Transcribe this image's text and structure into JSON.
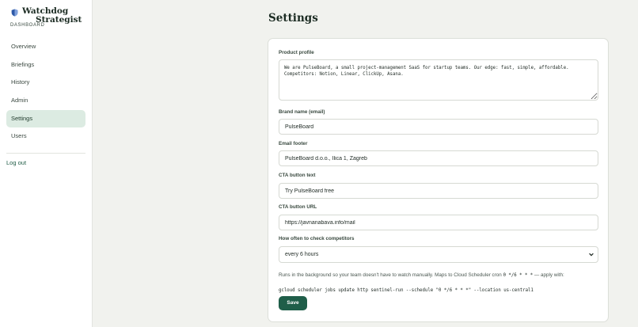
{
  "brand": {
    "name_line1": "Watchdog",
    "name_line2": "Strategist",
    "subtitle": "DASHBOARD",
    "icon": "shield-icon",
    "icon_color": "#2f5aa8"
  },
  "sidebar": {
    "items": [
      {
        "label": "Overview",
        "active": false
      },
      {
        "label": "Briefings",
        "active": false
      },
      {
        "label": "History",
        "active": false
      },
      {
        "label": "Admin",
        "active": false
      },
      {
        "label": "Settings",
        "active": true
      },
      {
        "label": "Users",
        "active": false
      }
    ],
    "logout_label": "Log out"
  },
  "page": {
    "title": "Settings"
  },
  "form": {
    "product_profile": {
      "label": "Product profile",
      "value": "We are PulseBoard, a small project-management SaaS for startup teams. Our edge: fast, simple, affordable.\nCompetitors: Notion, Linear, ClickUp, Asana."
    },
    "brand_name": {
      "label": "Brand name (email)",
      "value": "PulseBoard"
    },
    "email_footer": {
      "label": "Email footer",
      "value": "PulseBoard d.o.o., Ilica 1, Zagreb"
    },
    "cta_text": {
      "label": "CTA button text",
      "value": "Try PulseBoard free"
    },
    "cta_url": {
      "label": "CTA button URL",
      "value": "https://javnanabava.info/mail"
    },
    "frequency": {
      "label": "How often to check competitors",
      "selected": "every 6 hours"
    },
    "hint": {
      "text_before": "Runs in the background so your team doesn't have to watch manually. Maps to Cloud Scheduler cron ",
      "cron": "0 */6 * * *",
      "text_after": " — apply with:",
      "command": "gcloud scheduler jobs update http sentinel-run --schedule \"0 */6 * * *\" --location us-central1"
    },
    "save_label": "Save"
  },
  "colors": {
    "accent": "#1f5e49",
    "active_nav_bg": "#dcebe2",
    "page_bg": "#f1f2ee"
  }
}
